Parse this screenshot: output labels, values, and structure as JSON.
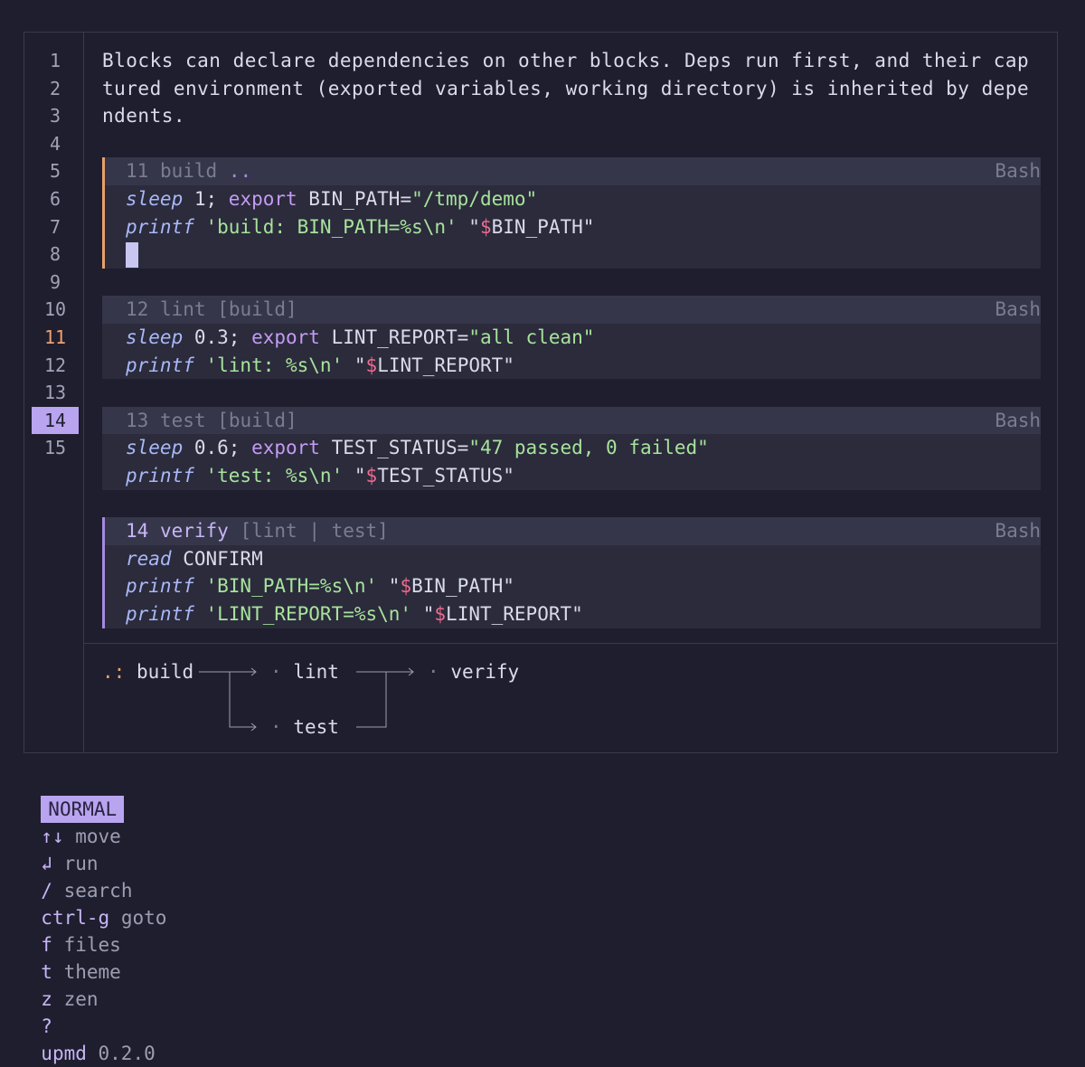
{
  "editor": {
    "line_numbers": [
      "1",
      "2",
      "3",
      "4",
      "5",
      "6",
      "7",
      "8",
      "9",
      "10",
      "11",
      "12",
      "13",
      "14",
      "15"
    ],
    "current_line": "11",
    "selected_line": "14",
    "paragraph": [
      "Blocks can declare dependencies on other blocks. Deps run first, and their cap",
      "tured environment (exported variables, working directory) is inherited by depe",
      "ndents."
    ]
  },
  "blocks": [
    {
      "index": "11",
      "name": "build",
      "deps": "..",
      "lang": "Bash",
      "lines": [
        {
          "kw": "sleep",
          "rest": " 1; ",
          "pl": "export",
          "var": " BIN_PATH=",
          "str": "\"/tmp/demo\""
        },
        {
          "kw": "printf",
          "str1": " 'build: BIN_PATH=%s\\n' ",
          "q": "\"",
          "dol": "$",
          "var": "BIN_PATH",
          "q2": "\""
        }
      ]
    },
    {
      "index": "12",
      "name": "lint",
      "deps": "[build]",
      "lang": "Bash",
      "lines": [
        {
          "kw": "sleep",
          "rest": " 0.3; ",
          "pl": "export",
          "var": " LINT_REPORT=",
          "str": "\"all clean\""
        },
        {
          "kw": "printf",
          "str1": " 'lint: %s\\n' ",
          "q": "\"",
          "dol": "$",
          "var": "LINT_REPORT",
          "q2": "\""
        }
      ]
    },
    {
      "index": "13",
      "name": "test",
      "deps": "[build]",
      "lang": "Bash",
      "lines": [
        {
          "kw": "sleep",
          "rest": " 0.6; ",
          "pl": "export",
          "var": " TEST_STATUS=",
          "str": "\"47 passed, 0 failed\""
        },
        {
          "kw": "printf",
          "str1": " 'test: %s\\n' ",
          "q": "\"",
          "dol": "$",
          "var": "TEST_STATUS",
          "q2": "\""
        }
      ]
    },
    {
      "index": "14",
      "name": "verify",
      "deps": "[lint | test]",
      "lang": "Bash",
      "lines": [
        {
          "kw": "read",
          "plain": " CONFIRM"
        },
        {
          "kw": "printf",
          "str1": " 'BIN_PATH=%s\\n' ",
          "q": "\"",
          "dol": "$",
          "var": "BIN_PATH",
          "q2": "\""
        },
        {
          "kw": "printf",
          "str1": " 'LINT_REPORT=%s\\n' ",
          "q": "\"",
          "dol": "$",
          "var": "LINT_REPORT",
          "q2": "\""
        }
      ]
    }
  ],
  "graph": {
    "marker": ".:",
    "nodes": {
      "build": "build",
      "lint": "lint",
      "test": "test",
      "verify": "verify"
    },
    "bullet": "·"
  },
  "statusbar": {
    "mode": "NORMAL",
    "items": [
      {
        "key": "↑↓",
        "label": "move"
      },
      {
        "key": "↲",
        "label": "run"
      },
      {
        "key": "/",
        "label": "search"
      },
      {
        "key": "ctrl-g",
        "label": "goto"
      },
      {
        "key": "f",
        "label": "files"
      },
      {
        "key": "t",
        "label": "theme"
      },
      {
        "key": "z",
        "label": "zen"
      },
      {
        "key": "?",
        "label": ""
      }
    ],
    "app": "upmd",
    "version": "0.2.0"
  }
}
